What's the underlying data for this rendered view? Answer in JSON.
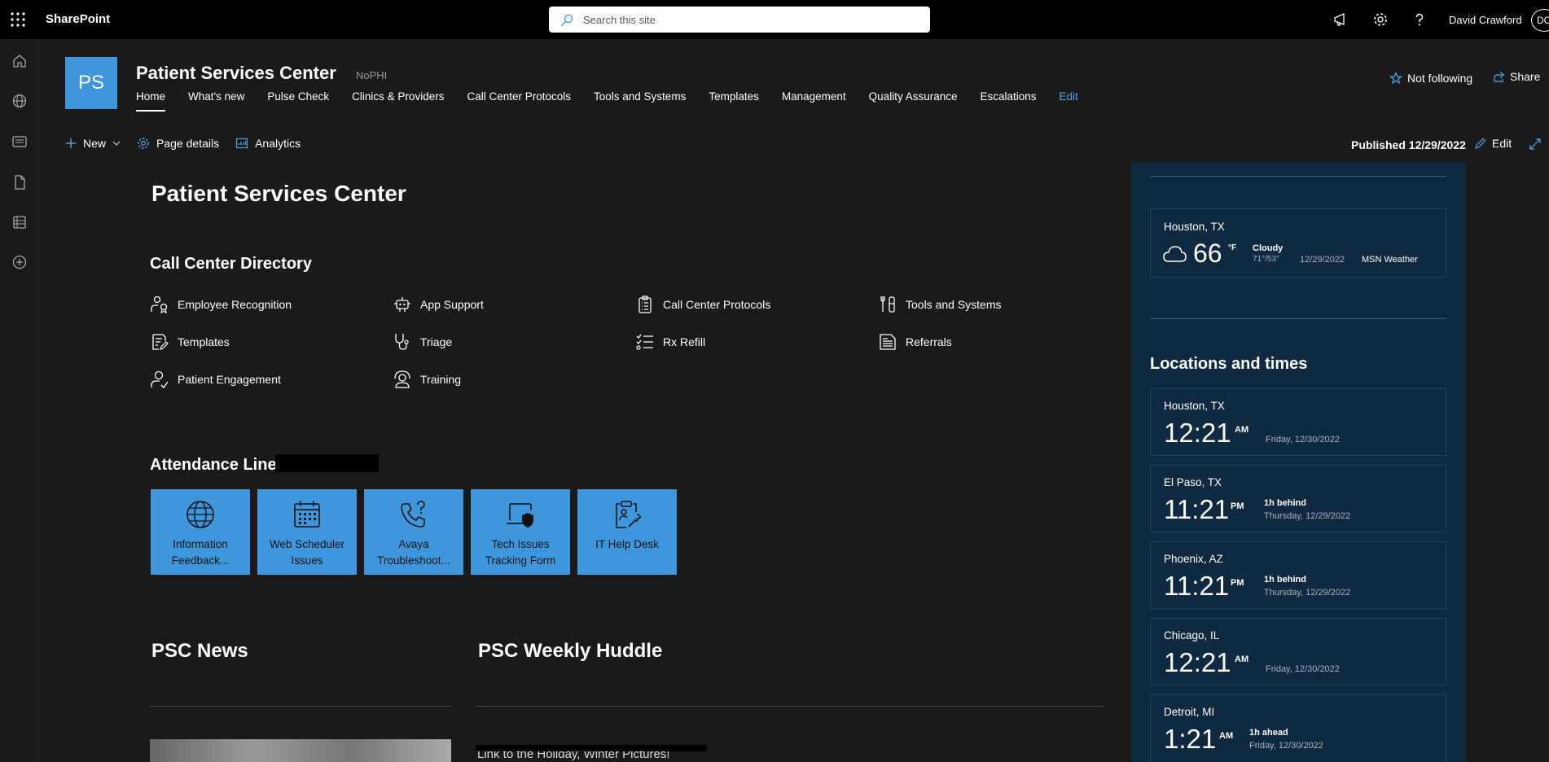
{
  "app": {
    "brand": "SharePoint"
  },
  "search": {
    "placeholder": "Search this site"
  },
  "user": {
    "name": "David Crawford",
    "initials": "DC"
  },
  "site": {
    "logo_text": "PS",
    "title": "Patient Services Center",
    "tag": "NoPHI",
    "follow_label": "Not following",
    "share_label": "Share"
  },
  "nav": [
    {
      "label": "Home"
    },
    {
      "label": "What's new"
    },
    {
      "label": "Pulse Check"
    },
    {
      "label": "Clinics & Providers"
    },
    {
      "label": "Call Center Protocols"
    },
    {
      "label": "Tools and Systems"
    },
    {
      "label": "Templates"
    },
    {
      "label": "Management"
    },
    {
      "label": "Quality Assurance"
    },
    {
      "label": "Escalations"
    },
    {
      "label": "Edit"
    }
  ],
  "commands": {
    "new": "New",
    "page_details": "Page details",
    "analytics": "Analytics",
    "published": "Published 12/29/2022",
    "edit": "Edit"
  },
  "page": {
    "title": "Patient Services Center",
    "directory_heading": "Call Center Directory",
    "attendance_heading": "Attendance Line:",
    "news_heading": "PSC News",
    "huddle_heading": "PSC Weekly Huddle",
    "huddle_item_text": "Link to the Holiday, Winter Pictures!"
  },
  "quick_links": [
    {
      "label": "Employee Recognition",
      "icon": "person-award-icon"
    },
    {
      "label": "App Support",
      "icon": "bot-icon"
    },
    {
      "label": "Call Center Protocols",
      "icon": "clipboard-list-icon"
    },
    {
      "label": "Tools and Systems",
      "icon": "tools-icon"
    },
    {
      "label": "Templates",
      "icon": "document-edit-icon"
    },
    {
      "label": "Triage",
      "icon": "stethoscope-icon"
    },
    {
      "label": "Rx Refill",
      "icon": "checklist-icon"
    },
    {
      "label": "Referrals",
      "icon": "document-text-icon"
    },
    {
      "label": "Patient Engagement",
      "icon": "person-check-icon"
    },
    {
      "label": "Training",
      "icon": "person-support-icon"
    }
  ],
  "tiles": [
    {
      "line1": "Information",
      "line2": "Feedback...",
      "icon": "globe-icon"
    },
    {
      "line1": "Web Scheduler",
      "line2": "Issues",
      "icon": "calendar-icon"
    },
    {
      "line1": "Avaya",
      "line2": "Troubleshoot...",
      "icon": "phone-question-icon"
    },
    {
      "line1": "Tech Issues",
      "line2": "Tracking Form",
      "icon": "laptop-shield-icon"
    },
    {
      "line1": "IT Help Desk",
      "line2": "",
      "icon": "clipboard-wrench-icon"
    }
  ],
  "weather": {
    "city": "Houston, TX",
    "temp": "66",
    "unit": "°F",
    "condition": "Cloudy",
    "hilo": "71°/53°",
    "date": "12/29/2022",
    "source": "MSN Weather"
  },
  "locations": {
    "heading": "Locations and times",
    "items": [
      {
        "city": "Houston, TX",
        "time": "12:21",
        "ampm": "AM",
        "offset": "",
        "date": "Friday, 12/30/2022"
      },
      {
        "city": "El Paso, TX",
        "time": "11:21",
        "ampm": "PM",
        "offset": "1h behind",
        "date": "Thursday, 12/29/2022"
      },
      {
        "city": "Phoenix, AZ",
        "time": "11:21",
        "ampm": "PM",
        "offset": "1h behind",
        "date": "Thursday, 12/29/2022"
      },
      {
        "city": "Chicago, IL",
        "time": "12:21",
        "ampm": "AM",
        "offset": "",
        "date": "Friday, 12/30/2022"
      },
      {
        "city": "Detroit, MI",
        "time": "1:21",
        "ampm": "AM",
        "offset": "1h ahead",
        "date": "Friday, 12/30/2022"
      }
    ]
  },
  "colors": {
    "accent": "#3e97dc",
    "link": "#4fa8f0",
    "panel": "#0f2a40",
    "background": "#1b1a19"
  }
}
